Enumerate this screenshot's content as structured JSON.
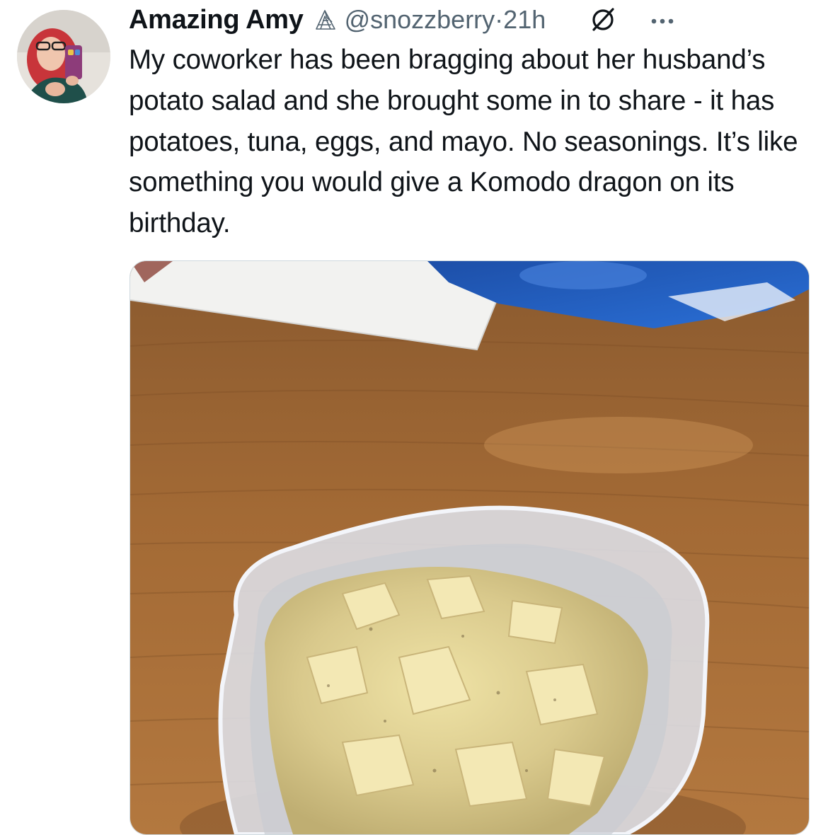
{
  "author": {
    "display_name": "Amazing Amy",
    "handle": "@snozzberry",
    "separator": "·",
    "timestamp": "21h",
    "avatar_icon": "profile-photo",
    "badge_icon": "line-art-bird-icon"
  },
  "actions": {
    "grok_icon": "slashed-circle-icon",
    "more_icon": "more-dots-icon"
  },
  "tweet": {
    "text": "My coworker has been bragging about her husband’s potato salad and she brought some in to share - it has potatoes, tuna, eggs, and mayo. No seasonings. It’s like something you would give a Komodo dragon on its birthday."
  },
  "media": {
    "kind": "photo",
    "depicts": [
      "wooden-table",
      "white-paper",
      "blue-bag",
      "plastic-container",
      "potato-salad"
    ]
  },
  "colors": {
    "text": "#0f1419",
    "secondary": "#536471",
    "border": "#cfd9de",
    "background": "#ffffff"
  }
}
